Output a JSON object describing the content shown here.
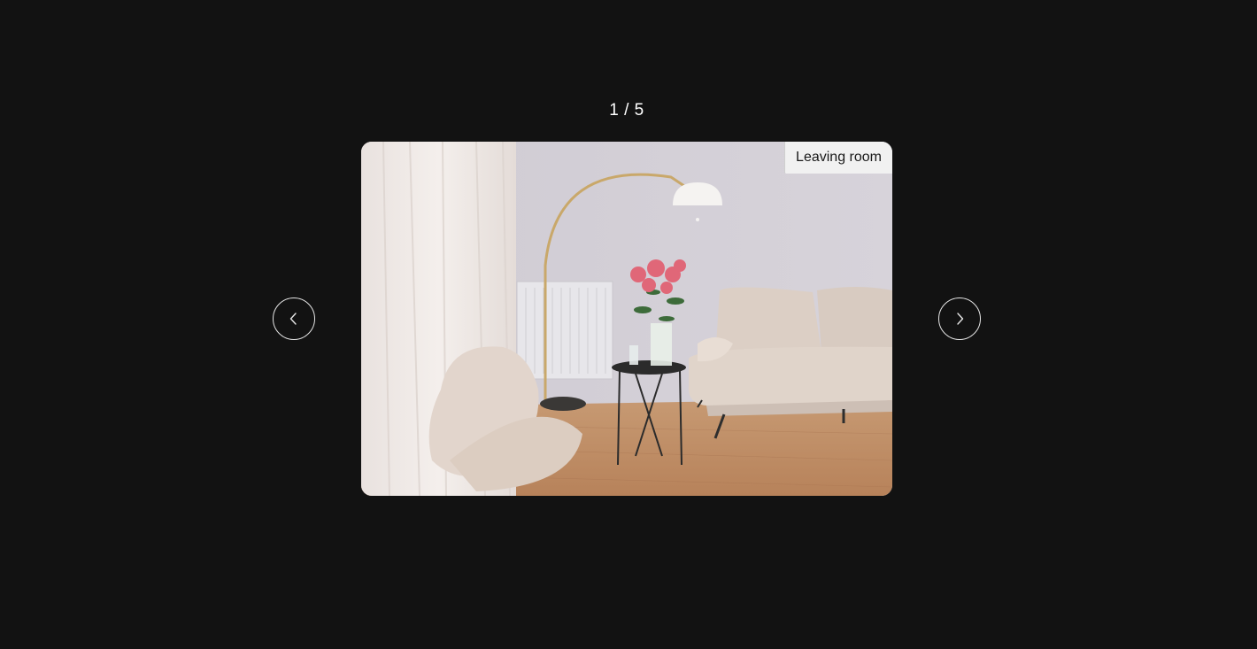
{
  "gallery": {
    "counter": "1 / 5",
    "caption": "Leaving room",
    "prev_icon": "chevron-left-icon",
    "next_icon": "chevron-right-icon",
    "photo_alt": "Leaving room"
  },
  "colors": {
    "background": "#121212",
    "counter_text": "#ffffff",
    "button_border": "#e6e6e6",
    "caption_bg": "#f1f1f1",
    "caption_text": "#1a1a1a"
  }
}
